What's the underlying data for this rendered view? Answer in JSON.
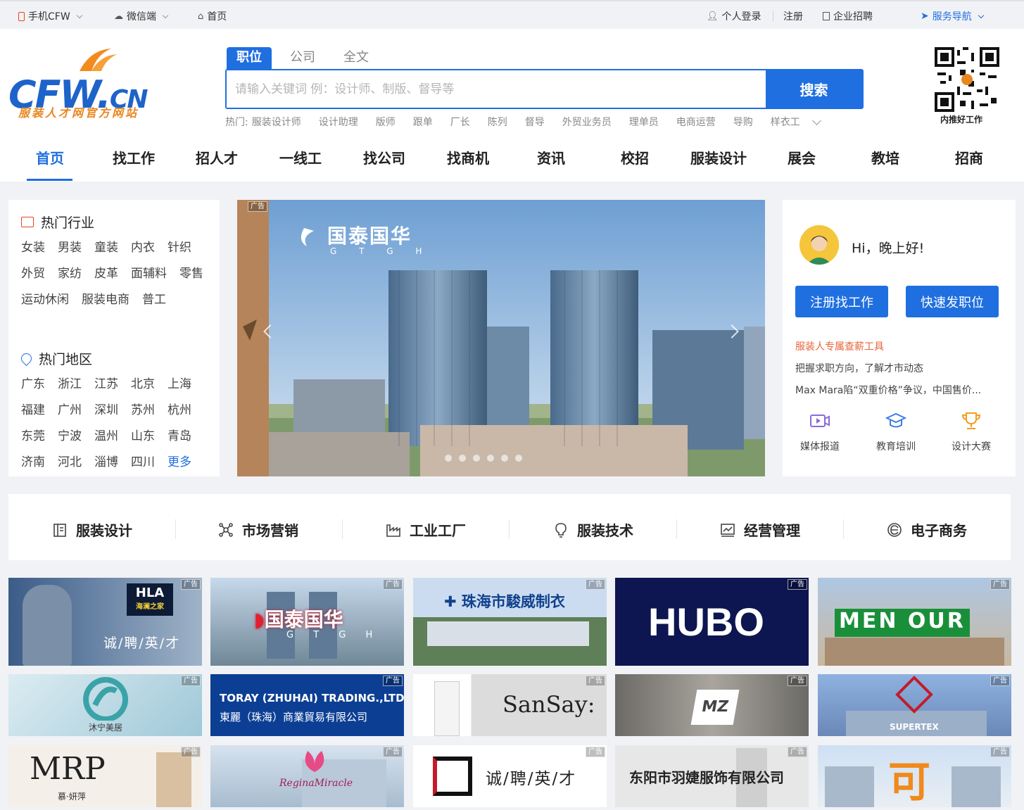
{
  "topbar": {
    "mobile": "手机CFW",
    "wechat": "微信端",
    "home": "首页",
    "login": "个人登录",
    "register": "注册",
    "company_recruit": "企业招聘",
    "service_nav": "服务导航"
  },
  "logo": {
    "main": "CFW.",
    "suffix": "CN",
    "sub": "服装人才网官方网站"
  },
  "search": {
    "tabs": [
      "职位",
      "公司",
      "全文"
    ],
    "placeholder": "请输入关键词 例：设计师、制版、督导等",
    "button": "搜索",
    "hot_label": "热门:",
    "hot": [
      "服装设计师",
      "设计助理",
      "版师",
      "跟单",
      "厂长",
      "陈列",
      "督导",
      "外贸业务员",
      "理单员",
      "电商运营",
      "导购",
      "样衣工"
    ]
  },
  "qr": {
    "caption": "内推好工作"
  },
  "nav": [
    "首页",
    "找工作",
    "招人才",
    "一线工",
    "找公司",
    "找商机",
    "资讯",
    "校招",
    "服装设计",
    "展会",
    "教培",
    "招商"
  ],
  "industries": {
    "title": "热门行业",
    "items": [
      "女装",
      "男装",
      "童装",
      "内衣",
      "针织",
      "外贸",
      "家纺",
      "皮革",
      "面辅料",
      "零售",
      "运动休闲",
      "服装电商",
      "普工"
    ]
  },
  "regions": {
    "title": "热门地区",
    "items": [
      "广东",
      "浙江",
      "江苏",
      "北京",
      "上海",
      "福建",
      "广州",
      "深圳",
      "苏州",
      "杭州",
      "东莞",
      "宁波",
      "温州",
      "山东",
      "青岛",
      "济南",
      "河北",
      "淄博",
      "四川"
    ],
    "more": "更多"
  },
  "banner": {
    "ad": "广告",
    "brand": "国泰国华",
    "brand_en": "G T G H"
  },
  "user": {
    "greeting": "Hi，晚上好!",
    "btn_register": "注册找工作",
    "btn_post": "快速发职位",
    "link1": "服装人专属查薪工具",
    "link2": "把握求职方向，了解才市动态",
    "link3": "Max Mara陷“双重价格”争议，中国售价...",
    "icons": [
      "媒体报道",
      "教育培训",
      "设计大赛"
    ]
  },
  "categories": [
    "服装设计",
    "市场营销",
    "工业工厂",
    "服装技术",
    "经营管理",
    "电子商务"
  ],
  "ads": {
    "tag": "广告",
    "r1": [
      {
        "brand": "HLA",
        "brand2": "海澜之家",
        "text": "诚/聘/英/才"
      },
      {
        "brand": "国泰国华",
        "text": "G T G H"
      },
      {
        "text": "珠海市駿威制衣"
      },
      {
        "text": "HUBO"
      },
      {
        "text": "MEN OUR"
      }
    ],
    "r2": [
      {
        "text": "沐宁美居"
      },
      {
        "text": "TORAY (ZHUHAI) TRADING.,LTD.",
        "text2": "東麗（珠海）商業貿易有限公司"
      },
      {
        "text": "SanSay:"
      },
      {
        "text": "MZ"
      },
      {
        "text": "SUPERTEX"
      }
    ],
    "r3": [
      {
        "text": "MRP",
        "text2": "慕·妍萍"
      },
      {
        "text": "ReginaMiracle"
      },
      {
        "text": "诚/聘/英/才"
      },
      {
        "text": "东阳市羽婕服饰有限公司"
      },
      {
        "text": "可"
      }
    ]
  },
  "colors": {
    "accent": "#1f6fe0",
    "orange": "#e9861e",
    "link_orange": "#e8643a"
  }
}
